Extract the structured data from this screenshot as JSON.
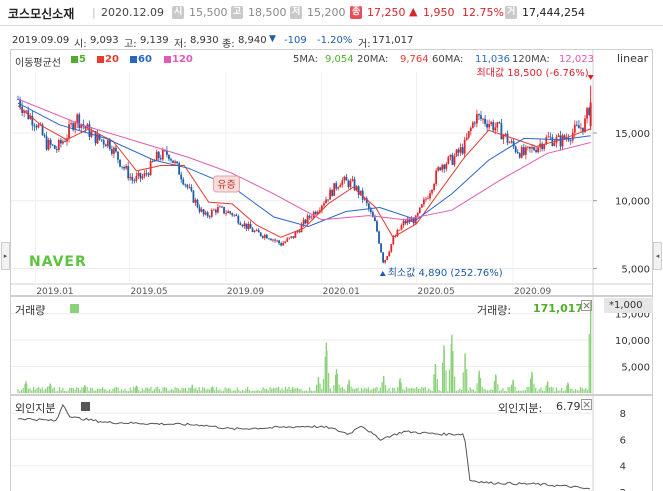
{
  "header": {
    "name": "코스모신소재",
    "date": "2020.12.09",
    "open_badge": "시",
    "open": "15,500",
    "high_badge": "고",
    "high": "18,500",
    "low_badge": "저",
    "low": "15,200",
    "close_badge": "종",
    "close": "17,250",
    "change_arrow": "▲",
    "change": "1,950",
    "change_pct": "12.75%",
    "volume_badge": "거",
    "volume": "17,444,254"
  },
  "infobar": {
    "date": "2019.09.09",
    "open_label": "시",
    "open": "9,093",
    "high_label": "고",
    "high": "9,139",
    "low_label": "저",
    "low": "8,930",
    "close_label": "종",
    "close": "8,940",
    "change_arrow": "▼",
    "change": "-109",
    "change_pct": "-1.20%",
    "volume_label": "거",
    "volume": "171,017"
  },
  "colors": {
    "up": "#e1272d",
    "down": "#1e5ba8",
    "ma5": "#4fae2b",
    "ma20": "#e83a2f",
    "ma60": "#2a66c8",
    "ma120": "#e05ab6",
    "volume": "#8bd17a",
    "foreign": "#555555",
    "naver": "#5ec43d"
  },
  "main": {
    "ma_legend_title": "이동평균선",
    "ma_items": [
      "5",
      "20",
      "60",
      "120"
    ],
    "ma_values": [
      {
        "label": "5MA:",
        "value": "9,054"
      },
      {
        "label": "20MA:",
        "value": "9,764"
      },
      {
        "label": "60MA:",
        "value": "11,036"
      },
      {
        "label": "120MA:",
        "value": "12,023"
      }
    ],
    "scale_label": "linear",
    "max_annotation": "최대값 18,500 (-6.76%)",
    "min_annotation": "최소값 4,890 (252.76%)",
    "event_annotation": "유증",
    "watermark": "NAVER",
    "y_ticks": [
      "15,000",
      "10,000",
      "5,000"
    ],
    "x_ticks": [
      "2019.01",
      "2019.05",
      "2019.09",
      "2020.01",
      "2020.05",
      "2020.09"
    ]
  },
  "volume_panel": {
    "title": "거래량",
    "value_label": "거래량:",
    "value": "171,017",
    "unit": "*1,000",
    "y_ticks": [
      "15,000",
      "10,000",
      "5,000"
    ]
  },
  "foreign_panel": {
    "title": "외인지분",
    "value_label": "외인지분:",
    "value": "6.79",
    "y_ticks": [
      "8",
      "6",
      "4",
      "2"
    ]
  },
  "chart_data": [
    {
      "type": "line",
      "title": "",
      "x_range": [
        "2018.12",
        "2020.12"
      ],
      "ylim": [
        4000,
        19500
      ],
      "x_ticks": [
        "2019.01",
        "2019.05",
        "2019.09",
        "2020.01",
        "2020.05",
        "2020.09"
      ],
      "y_ticks": [
        15000,
        10000,
        5000
      ],
      "scale": "linear",
      "series": [
        {
          "name": "5",
          "points": [
            [
              "2018-12-10",
              17500
            ],
            [
              "2018-12-20",
              16500
            ],
            [
              "2019-01-02",
              15800
            ],
            [
              "2019-01-15",
              14200
            ],
            [
              "2019-01-28",
              13800
            ],
            [
              "2019-02-10",
              14800
            ],
            [
              "2019-02-22",
              16200
            ],
            [
              "2019-03-05",
              15400
            ],
            [
              "2019-03-20",
              14600
            ],
            [
              "2019-04-05",
              14300
            ],
            [
              "2019-04-20",
              12800
            ],
            [
              "2019-05-05",
              11500
            ],
            [
              "2019-05-20",
              11800
            ],
            [
              "2019-06-05",
              13200
            ],
            [
              "2019-06-20",
              13500
            ],
            [
              "2019-07-05",
              12000
            ],
            [
              "2019-07-20",
              10300
            ],
            [
              "2019-08-05",
              8800
            ],
            [
              "2019-08-20",
              9400
            ],
            [
              "2019-09-09",
              9054
            ],
            [
              "2019-09-25",
              8200
            ],
            [
              "2019-10-10",
              7600
            ],
            [
              "2019-10-25",
              7400
            ],
            [
              "2019-11-10",
              6800
            ],
            [
              "2019-11-25",
              7300
            ],
            [
              "2019-12-10",
              8400
            ],
            [
              "2019-12-25",
              9300
            ],
            [
              "2020-01-10",
              10400
            ],
            [
              "2020-01-25",
              11500
            ],
            [
              "2020-02-10",
              11200
            ],
            [
              "2020-02-25",
              10000
            ],
            [
              "2020-03-10",
              8200
            ],
            [
              "2020-03-20",
              5400
            ],
            [
              "2020-04-01",
              7100
            ],
            [
              "2020-04-15",
              8400
            ],
            [
              "2020-04-30",
              8600
            ],
            [
              "2020-05-15",
              10400
            ],
            [
              "2020-06-01",
              12700
            ],
            [
              "2020-06-15",
              13000
            ],
            [
              "2020-07-01",
              14000
            ],
            [
              "2020-07-15",
              16200
            ],
            [
              "2020-08-01",
              15800
            ],
            [
              "2020-08-15",
              15200
            ],
            [
              "2020-09-01",
              14000
            ],
            [
              "2020-09-15",
              13400
            ],
            [
              "2020-10-01",
              14000
            ],
            [
              "2020-10-15",
              14600
            ],
            [
              "2020-11-01",
              14400
            ],
            [
              "2020-11-15",
              15000
            ],
            [
              "2020-12-01",
              15600
            ],
            [
              "2020-12-09",
              17250
            ]
          ]
        },
        {
          "name": "20",
          "points": [
            [
              "2018-12-10",
              17000
            ],
            [
              "2019-01-10",
              15500
            ],
            [
              "2019-02-10",
              14500
            ],
            [
              "2019-03-10",
              15300
            ],
            [
              "2019-04-10",
              14400
            ],
            [
              "2019-05-10",
              12200
            ],
            [
              "2019-06-10",
              12600
            ],
            [
              "2019-07-10",
              12600
            ],
            [
              "2019-08-10",
              9900
            ],
            [
              "2019-09-09",
              9764
            ],
            [
              "2019-10-10",
              8200
            ],
            [
              "2019-11-10",
              7300
            ],
            [
              "2019-12-10",
              8000
            ],
            [
              "2020-01-10",
              9800
            ],
            [
              "2020-02-10",
              11000
            ],
            [
              "2020-03-10",
              9500
            ],
            [
              "2020-04-01",
              7300
            ],
            [
              "2020-05-01",
              8300
            ],
            [
              "2020-06-01",
              10800
            ],
            [
              "2020-07-01",
              13200
            ],
            [
              "2020-08-01",
              15200
            ],
            [
              "2020-09-01",
              14600
            ],
            [
              "2020-10-01",
              14000
            ],
            [
              "2020-11-01",
              14500
            ],
            [
              "2020-12-09",
              15300
            ]
          ]
        },
        {
          "name": "60",
          "points": [
            [
              "2018-12-10",
              17200
            ],
            [
              "2019-02-01",
              15600
            ],
            [
              "2019-04-01",
              14600
            ],
            [
              "2019-06-01",
              13000
            ],
            [
              "2019-07-15",
              12400
            ],
            [
              "2019-09-09",
              11036
            ],
            [
              "2019-11-01",
              8800
            ],
            [
              "2019-12-15",
              8100
            ],
            [
              "2020-02-01",
              9200
            ],
            [
              "2020-03-15",
              9500
            ],
            [
              "2020-05-01",
              8600
            ],
            [
              "2020-06-15",
              10500
            ],
            [
              "2020-08-01",
              13000
            ],
            [
              "2020-09-15",
              14600
            ],
            [
              "2020-11-01",
              14500
            ],
            [
              "2020-12-09",
              14800
            ]
          ]
        },
        {
          "name": "120",
          "points": [
            [
              "2018-12-10",
              17500
            ],
            [
              "2019-03-01",
              15600
            ],
            [
              "2019-05-15",
              14300
            ],
            [
              "2019-07-15",
              13200
            ],
            [
              "2019-09-09",
              12023
            ],
            [
              "2019-11-01",
              10500
            ],
            [
              "2020-01-01",
              8600
            ],
            [
              "2020-03-01",
              8900
            ],
            [
              "2020-04-15",
              8600
            ],
            [
              "2020-06-15",
              9300
            ],
            [
              "2020-08-15",
              11500
            ],
            [
              "2020-10-15",
              13500
            ],
            [
              "2020-12-09",
              14300
            ]
          ]
        }
      ]
    },
    {
      "type": "bar",
      "title": "거래량",
      "unit": "*1,000",
      "ylim": [
        0,
        17000
      ],
      "y_ticks": [
        15000,
        10000,
        5000
      ],
      "spikes": [
        [
          "2018-12-20",
          2200
        ],
        [
          "2019-01-20",
          1800
        ],
        [
          "2019-03-05",
          1500
        ],
        [
          "2019-05-10",
          1400
        ],
        [
          "2019-07-20",
          1600
        ],
        [
          "2019-08-15",
          1200
        ],
        [
          "2019-11-25",
          1100
        ],
        [
          "2019-12-28",
          3000
        ],
        [
          "2020-01-07",
          9500
        ],
        [
          "2020-01-20",
          4500
        ],
        [
          "2020-02-05",
          2500
        ],
        [
          "2020-03-20",
          3200
        ],
        [
          "2020-04-10",
          2800
        ],
        [
          "2020-05-25",
          5500
        ],
        [
          "2020-06-05",
          9000
        ],
        [
          "2020-06-15",
          11000
        ],
        [
          "2020-07-02",
          7500
        ],
        [
          "2020-07-20",
          4200
        ],
        [
          "2020-08-10",
          3500
        ],
        [
          "2020-09-01",
          2500
        ],
        [
          "2020-09-25",
          4000
        ],
        [
          "2020-10-15",
          2200
        ],
        [
          "2020-11-10",
          2000
        ],
        [
          "2020-12-09",
          17444
        ]
      ],
      "current_value": 171017
    },
    {
      "type": "line",
      "title": "외인지분",
      "ylim": [
        2,
        9
      ],
      "y_ticks": [
        8,
        6,
        4,
        2
      ],
      "series": [
        {
          "name": "외인지분",
          "points": [
            [
              "2018-12-10",
              7.6
            ],
            [
              "2019-01-10",
              7.5
            ],
            [
              "2019-01-28",
              7.4
            ],
            [
              "2019-02-05",
              8.7
            ],
            [
              "2019-02-15",
              7.7
            ],
            [
              "2019-04-01",
              7.3
            ],
            [
              "2019-06-01",
              7.2
            ],
            [
              "2019-08-01",
              7.1
            ],
            [
              "2019-09-09",
              6.79
            ],
            [
              "2019-11-01",
              6.9
            ],
            [
              "2019-12-15",
              7.0
            ],
            [
              "2020-01-10",
              6.9
            ],
            [
              "2020-02-05",
              6.4
            ],
            [
              "2020-02-20",
              7.1
            ],
            [
              "2020-03-15",
              6.0
            ],
            [
              "2020-04-15",
              6.6
            ],
            [
              "2020-06-01",
              6.4
            ],
            [
              "2020-07-01",
              6.4
            ],
            [
              "2020-07-08",
              2.9
            ],
            [
              "2020-08-01",
              2.7
            ],
            [
              "2020-10-01",
              2.6
            ],
            [
              "2020-11-15",
              2.4
            ],
            [
              "2020-12-09",
              2.2
            ]
          ]
        }
      ]
    }
  ]
}
